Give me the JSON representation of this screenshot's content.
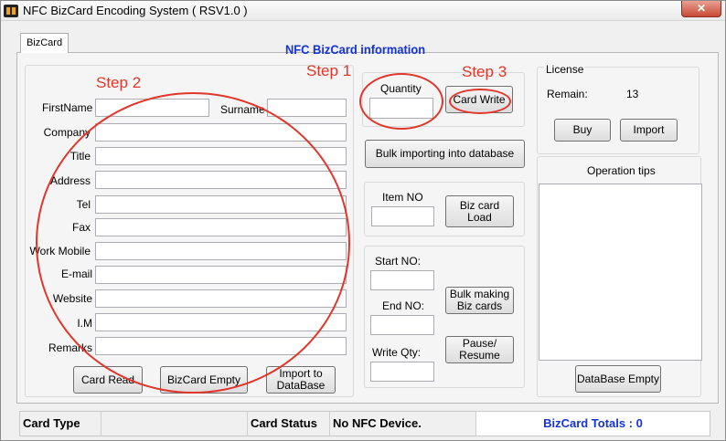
{
  "window": {
    "title": "NFC BizCard Encoding System ( RSV1.0 )",
    "close_label": "✕"
  },
  "tab": {
    "label": "BizCard"
  },
  "heading": "NFC BizCard information",
  "annotations": {
    "step1": "Step 1",
    "step2": "Step 2",
    "step3": "Step 3"
  },
  "form": {
    "firstname": "FirstName",
    "surname": "Surname",
    "company": "Company",
    "title": "Title",
    "address": "Address",
    "tel": "Tel",
    "fax": "Fax",
    "work_mobile": "Work Mobile",
    "email": "E-mail",
    "website": "Website",
    "im": "I.M",
    "remarks": "Remarks"
  },
  "form_buttons": {
    "card_read": "Card Read",
    "bizcard_empty": "BizCard Empty",
    "import_db": "Import to DataBase"
  },
  "quantity": {
    "label": "Quantity",
    "card_write": "Card Write"
  },
  "bulk_import": "Bulk importing into database",
  "item": {
    "label": "Item NO",
    "load": "Biz card Load"
  },
  "bulk": {
    "start_label": "Start NO:",
    "end_label": "End NO:",
    "qty_label": "Write Qty:",
    "making": "Bulk making Biz cards",
    "pause": "Pause/ Resume"
  },
  "license": {
    "title": "License",
    "remain_label": "Remain:",
    "remain_value": "13",
    "buy": "Buy",
    "import": "Import"
  },
  "tips": {
    "title": "Operation tips"
  },
  "db_empty": "DataBase Empty",
  "status": {
    "card_type_label": "Card Type",
    "card_type_value": "",
    "card_status_label": "Card Status",
    "card_status_value": "No NFC Device.",
    "totals": "BizCard Totals : 0"
  },
  "colors": {
    "accent": "#1433d6",
    "annotation": "#e0362b"
  }
}
